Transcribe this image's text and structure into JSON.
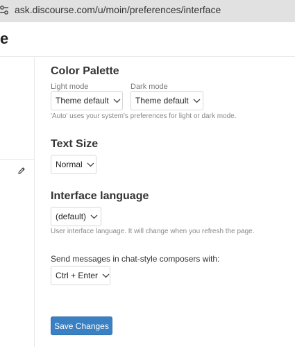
{
  "browser": {
    "url": "ask.discourse.com/u/moin/preferences/interface"
  },
  "header": {
    "title_fragment": "e"
  },
  "color_palette": {
    "title": "Color Palette",
    "light": {
      "label": "Light mode",
      "value": "Theme default"
    },
    "dark": {
      "label": "Dark mode",
      "value": "Theme default"
    },
    "description": "'Auto' uses your system's preferences for light or dark mode."
  },
  "text_size": {
    "title": "Text Size",
    "value": "Normal"
  },
  "interface_language": {
    "title": "Interface language",
    "value": "(default)",
    "description": "User interface language. It will change when you refresh the page."
  },
  "chat_send": {
    "label": "Send messages in chat-style composers with:",
    "value": "Ctrl + Enter"
  },
  "actions": {
    "save_label": "Save Changes"
  },
  "colors": {
    "primary_button": "#3a80c2",
    "url_bar": "#e1e1e1"
  }
}
